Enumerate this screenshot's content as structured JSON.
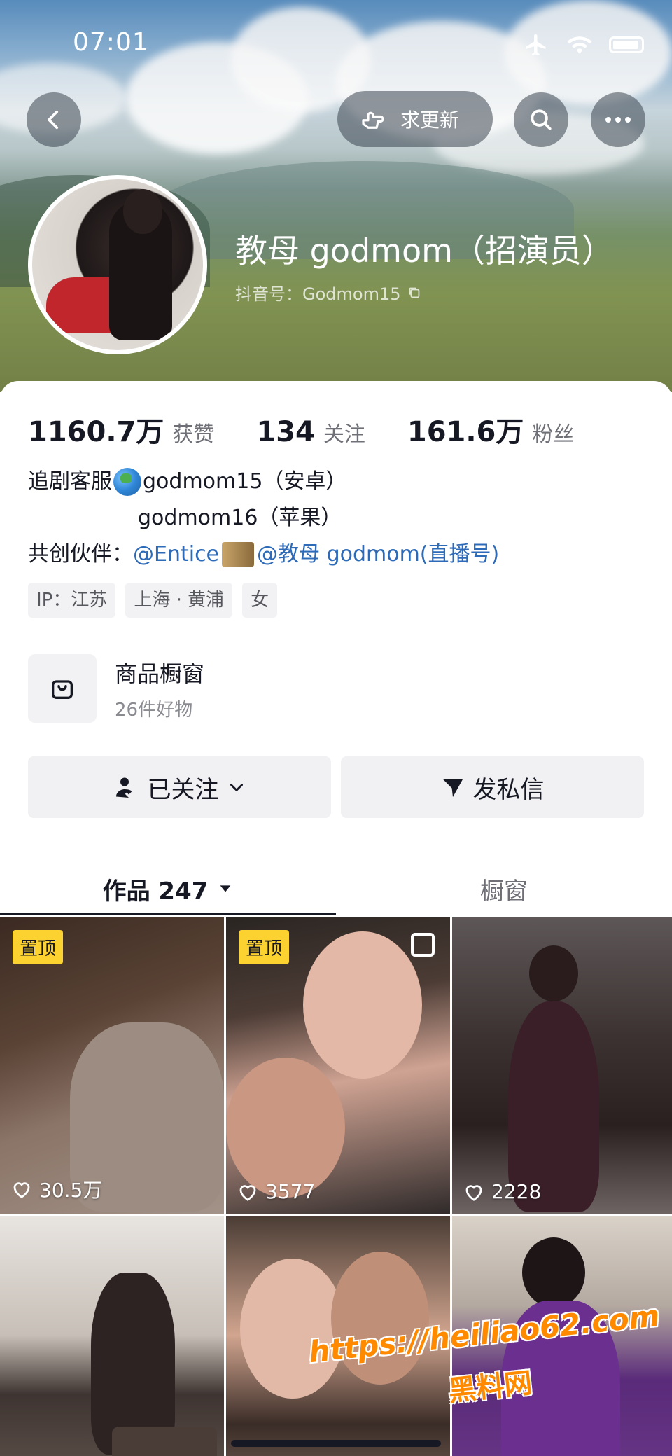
{
  "status_bar": {
    "time": "07:01"
  },
  "header": {
    "request_update_label": "求更新",
    "display_name": "教母 godmom（招演员）",
    "handle": "抖音号：Godmom15"
  },
  "stats": [
    {
      "value": "1160.7万",
      "label": "获赞"
    },
    {
      "value": "134",
      "label": "关注"
    },
    {
      "value": "161.6万",
      "label": "粉丝"
    }
  ],
  "bio": {
    "line1_prefix": "追剧客服",
    "line1_suffix": "godmom15（安卓）",
    "line2": "godmom16（苹果）",
    "line3_prefix": "共创伙伴：",
    "link1": "@Entice",
    "link2": "@教母 godmom(直播号)"
  },
  "tags": [
    "IP：江苏",
    "上海 · 黄浦",
    "女"
  ],
  "shop": {
    "title": "商品橱窗",
    "subtitle": "26件好物"
  },
  "actions": {
    "follow_label": "已关注",
    "message_label": "发私信"
  },
  "tabs": {
    "works_label": "作品 247",
    "window_label": "橱窗"
  },
  "videos": [
    {
      "pinned": "置顶",
      "likes": "30.5万"
    },
    {
      "pinned": "置顶",
      "likes": "3577"
    },
    {
      "pinned": "",
      "likes": "2228"
    },
    {
      "pinned": "",
      "likes": ""
    },
    {
      "pinned": "",
      "likes": ""
    },
    {
      "pinned": "",
      "likes": ""
    }
  ],
  "watermark": {
    "url": "https://heiliao62.com",
    "name": "黑料网"
  },
  "colors": {
    "accent_link": "#2d6ab8",
    "pin_badge": "#fbd22f",
    "watermark": "#ff8a00"
  }
}
